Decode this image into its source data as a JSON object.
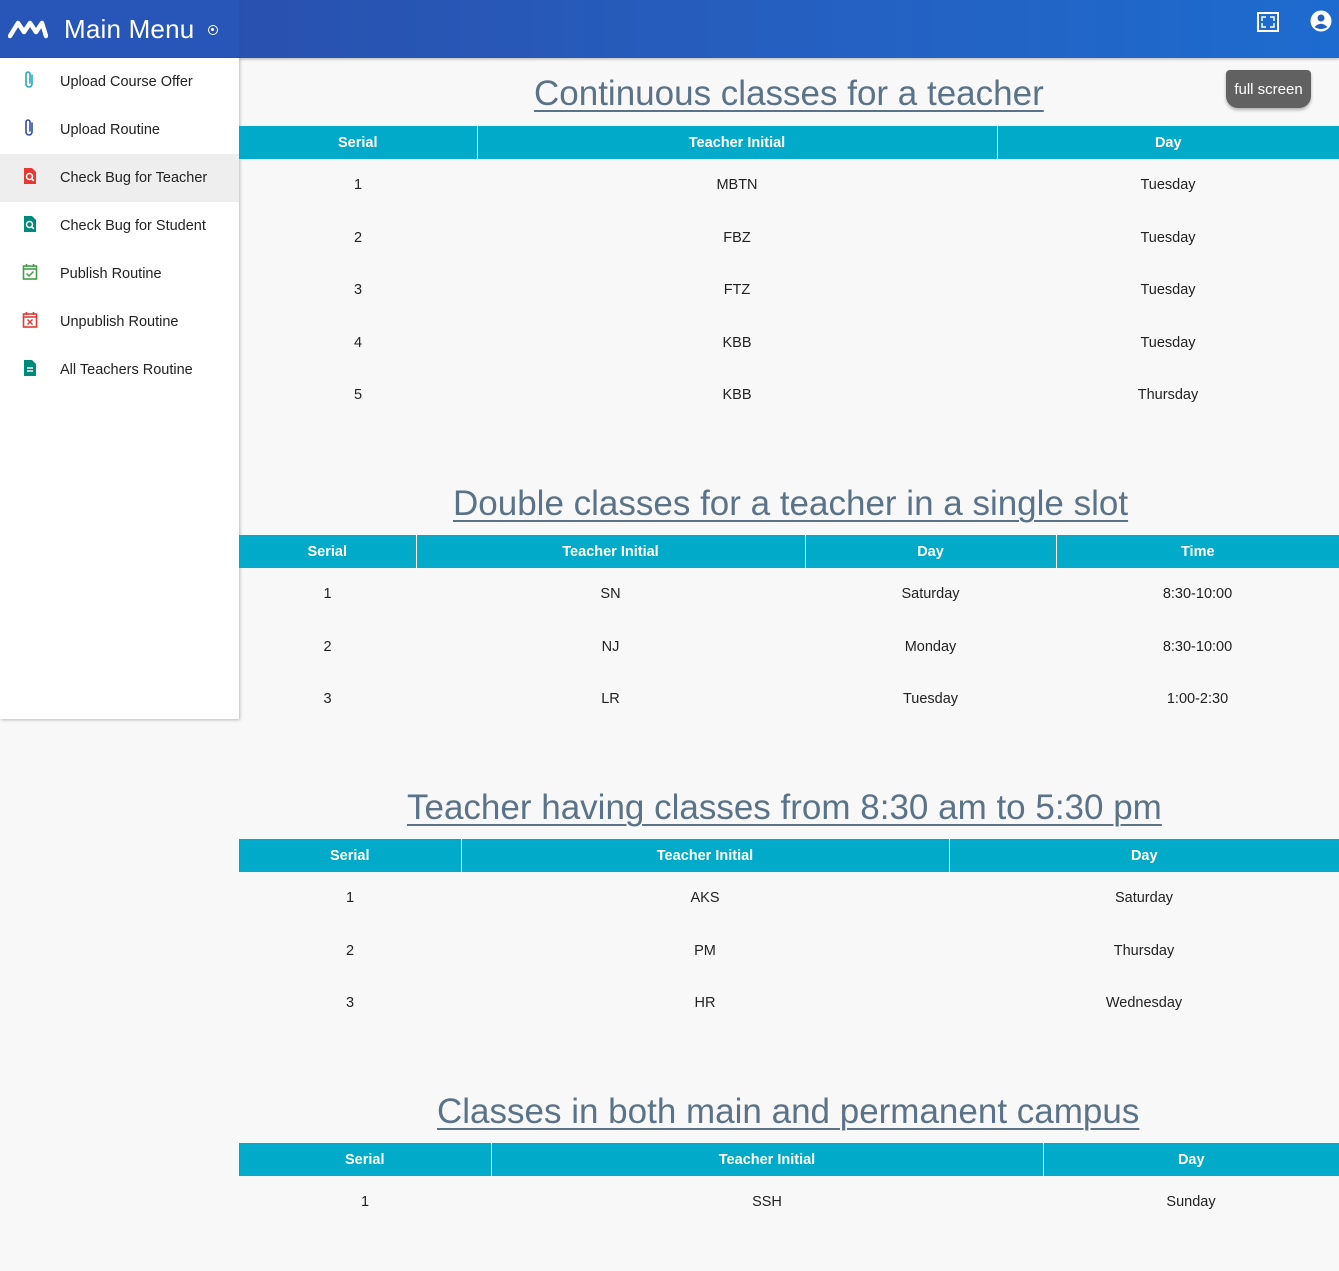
{
  "app": {
    "title": "Main Menu"
  },
  "header": {
    "fullscreen_icon": "fullscreen-icon",
    "user_icon": "account-circle-icon"
  },
  "sidebar": {
    "items": [
      {
        "label": "Upload Course Offer",
        "icon": "paperclip-icon",
        "color": "#26a9c4"
      },
      {
        "label": "Upload Routine",
        "icon": "paperclip-icon",
        "color": "#2f4ea8"
      },
      {
        "label": "Check Bug for Teacher",
        "icon": "file-search-icon",
        "color": "#e53935",
        "active": true
      },
      {
        "label": "Check Bug for Student",
        "icon": "file-search-icon",
        "color": "#00897b"
      },
      {
        "label": "Publish Routine",
        "icon": "calendar-check-icon",
        "color": "#43a047"
      },
      {
        "label": "Unpublish Routine",
        "icon": "calendar-remove-icon",
        "color": "#e53935"
      },
      {
        "label": "All Teachers Routine",
        "icon": "file-document-icon",
        "color": "#00897b"
      }
    ]
  },
  "main": {
    "fullscreen_button": "full screen",
    "sections": [
      {
        "title": "Continuous classes for a teacher",
        "columns": [
          "Serial",
          "Teacher Initial",
          "Day"
        ],
        "rows": [
          [
            "1",
            "MBTN",
            "Tuesday"
          ],
          [
            "2",
            "FBZ",
            "Tuesday"
          ],
          [
            "3",
            "FTZ",
            "Tuesday"
          ],
          [
            "4",
            "KBB",
            "Tuesday"
          ],
          [
            "5",
            "KBB",
            "Thursday"
          ]
        ]
      },
      {
        "title": "Double classes for a teacher in a single slot",
        "columns": [
          "Serial",
          "Teacher Initial",
          "Day",
          "Time"
        ],
        "rows": [
          [
            "1",
            "SN",
            "Saturday",
            "8:30-10:00"
          ],
          [
            "2",
            "NJ",
            "Monday",
            "8:30-10:00"
          ],
          [
            "3",
            "LR",
            "Tuesday",
            "1:00-2:30"
          ]
        ]
      },
      {
        "title": "Teacher having classes from 8:30 am to 5:30 pm",
        "columns": [
          "Serial",
          "Teacher Initial",
          "Day"
        ],
        "rows": [
          [
            "1",
            "AKS",
            "Saturday"
          ],
          [
            "2",
            "PM",
            "Thursday"
          ],
          [
            "3",
            "HR",
            "Wednesday"
          ]
        ]
      },
      {
        "title": "Classes in both main and permanent campus",
        "columns": [
          "Serial",
          "Teacher Initial",
          "Day"
        ],
        "rows": [
          [
            "1",
            "SSH",
            "Sunday"
          ]
        ]
      }
    ]
  },
  "colors": {
    "header_accent": "#00aac8",
    "title_color": "#5a7388",
    "topbar": "#2756b8"
  }
}
